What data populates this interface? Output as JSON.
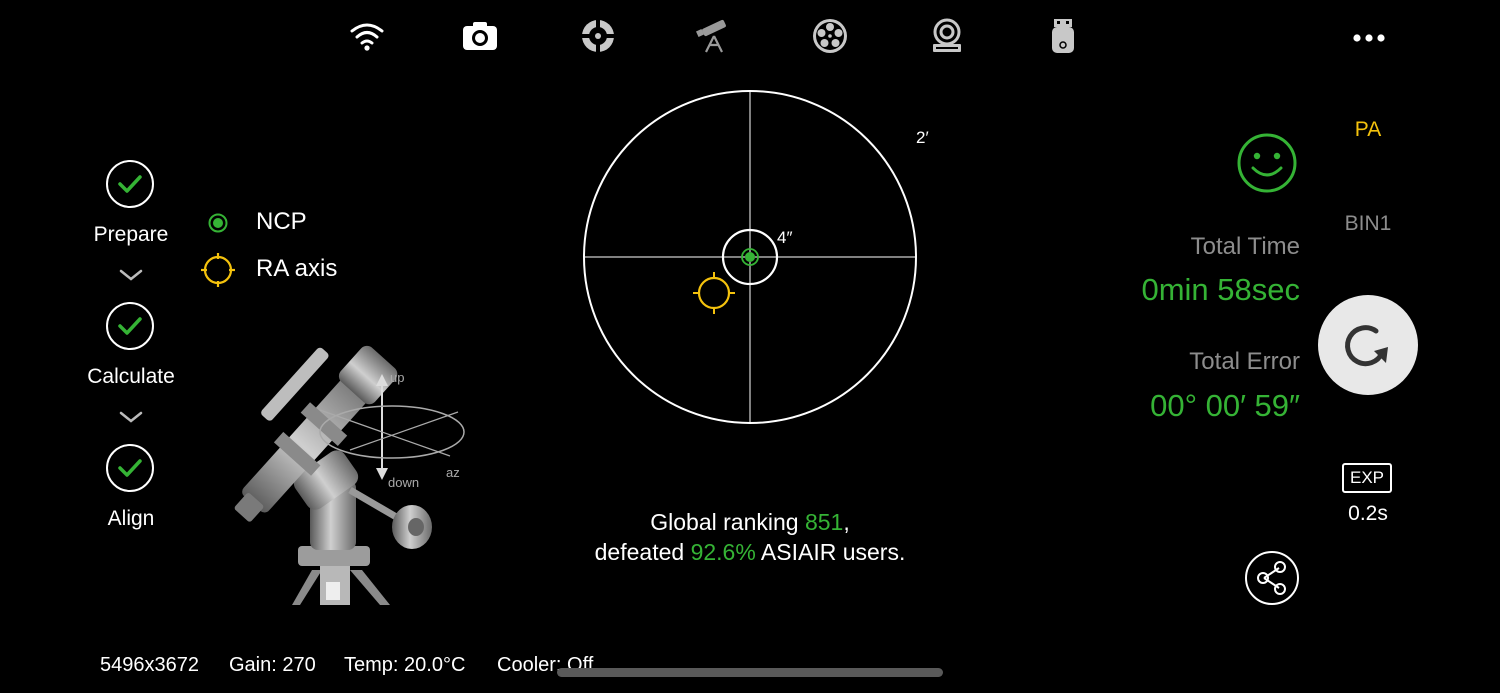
{
  "toolbar": {
    "icons": [
      "wifi-icon",
      "camera-icon",
      "guide-scope-icon",
      "telescope-mount-icon",
      "filter-wheel-icon",
      "focuser-icon",
      "usb-storage-icon"
    ],
    "more_icon": "more-dots-icon"
  },
  "steps": [
    {
      "label": "Prepare",
      "status": "done"
    },
    {
      "label": "Calculate",
      "status": "done"
    },
    {
      "label": "Align",
      "status": "done"
    }
  ],
  "legend": {
    "ncp_label": "NCP",
    "ra_axis_label": "RA axis"
  },
  "illustration": {
    "up_label": "up",
    "down_label": "down",
    "az_label": "az"
  },
  "target": {
    "outer_ring_label": "2′",
    "inner_ring_label": "4″",
    "ncp_color": "#35b335",
    "ra_color": "#f4c20d"
  },
  "ranking": {
    "prefix": "Global ranking ",
    "rank": "851",
    "suffix": ",",
    "defeated_prefix": "defeated ",
    "defeated_percent": "92.6%",
    "defeated_suffix": " ASIAIR users."
  },
  "results": {
    "total_time_label": "Total Time",
    "total_time_value": "0min 58sec",
    "total_error_label": "Total Error",
    "total_error_value": "00° 00′ 59″",
    "status_face": "smiley-icon"
  },
  "side_panel": {
    "mode": "PA",
    "bin": "BIN1",
    "exp_badge": "EXP",
    "exp_value": "0.2s"
  },
  "status_bar": {
    "resolution": "5496x3672",
    "gain": "Gain: 270",
    "temp": "Temp: 20.0°C",
    "cooler": "Cooler: Off"
  },
  "colors": {
    "accent_green": "#35b335",
    "accent_yellow": "#f4c20d",
    "muted_gray": "#8d8d8d"
  }
}
